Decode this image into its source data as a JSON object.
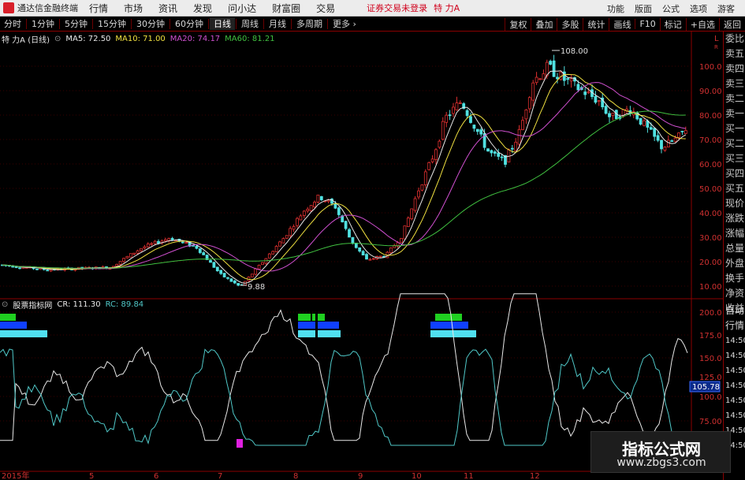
{
  "menubar": {
    "app_title": "通达信金融终端",
    "menus": [
      "行情",
      "市场",
      "资讯",
      "发现",
      "问小达",
      "财富圈",
      "交易"
    ],
    "login_status": "证券交易未登录",
    "stock_name": "特 力A",
    "right_items": [
      "功能",
      "版面",
      "公式",
      "选项",
      "游客"
    ]
  },
  "toolbar": {
    "periods": [
      "分时",
      "1分钟",
      "5分钟",
      "15分钟",
      "30分钟",
      "60分钟",
      "日线",
      "周线",
      "月线",
      "多周期",
      "更多 ›"
    ],
    "active_period": "日线",
    "right_buttons": [
      "复权",
      "叠加",
      "多股",
      "统计",
      "画线",
      "F10",
      "标记",
      "+自选",
      "返回"
    ]
  },
  "main_chart": {
    "title": "特 力A (日线)",
    "ma": [
      {
        "label": "MA5: 72.50",
        "color": "#e8e8e8"
      },
      {
        "label": "MA10: 71.00",
        "color": "#f0e040"
      },
      {
        "label": "MA20: 74.17",
        "color": "#d050d0"
      },
      {
        "label": "MA60: 81.21",
        "color": "#40c040"
      }
    ],
    "y_ticks": [
      "100.0",
      "90.00",
      "80.00",
      "70.00",
      "60.00",
      "50.00",
      "40.00",
      "30.00",
      "20.00",
      "10.00"
    ],
    "high_label": "108.00",
    "low_label": "9.88",
    "right_scale_top": "L",
    "right_scale_top_sub": "R"
  },
  "indicator": {
    "name": "股票指标网",
    "cr_label": "CR: 111.30",
    "rc_label": "RC: 89.84",
    "y_ticks": [
      "200.0",
      "175.0",
      "150.0",
      "125.0",
      "100.0",
      "75.00"
    ],
    "current_value": "105.78"
  },
  "x_axis": {
    "labels": [
      "2015年",
      "5",
      "6",
      "7",
      "8",
      "9",
      "10",
      "11",
      "12"
    ]
  },
  "right_panel": {
    "items": [
      "委比",
      "卖五",
      "卖四",
      "卖三",
      "卖二",
      "卖一",
      "买一",
      "买二",
      "买三",
      "买四",
      "买五",
      "现价",
      "涨跌",
      "涨幅",
      "总量",
      "外盘",
      "换手",
      "净资",
      "收益"
    ],
    "lower_items": [
      "自动",
      "行情",
      "14:50",
      "14:50",
      "14:50",
      "14:50",
      "14:50",
      "14:50",
      "14:50",
      "14:50"
    ]
  },
  "watermark": {
    "title": "指标公式网",
    "url": "www.zbgs3.com"
  },
  "colors": {
    "up": "#e03030",
    "down": "#50e0e0",
    "ma5": "#e8e8e8",
    "ma10": "#f0e040",
    "ma20": "#d050d0",
    "ma60": "#40c040",
    "cr_line": "#e8e8e8",
    "rc_line": "#50c8c8",
    "axis": "#8b0000"
  }
}
